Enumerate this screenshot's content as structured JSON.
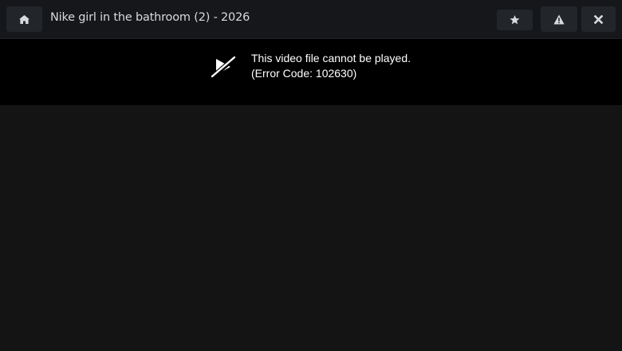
{
  "header": {
    "title": "Nike girl in the bathroom (2) - 2026",
    "home_icon": "home-icon",
    "star_icon": "star-icon",
    "warning_icon": "warning-icon",
    "close_icon": "close-icon"
  },
  "player": {
    "error_line1": "This video file cannot be played.",
    "error_line2": "(Error Code: 102630)",
    "error_icon": "video-off-icon"
  },
  "colors": {
    "topbar_bg": "#15171b",
    "button_bg": "#22252a",
    "player_bg": "#000000",
    "page_bg": "#141414",
    "text": "#d8dade"
  }
}
